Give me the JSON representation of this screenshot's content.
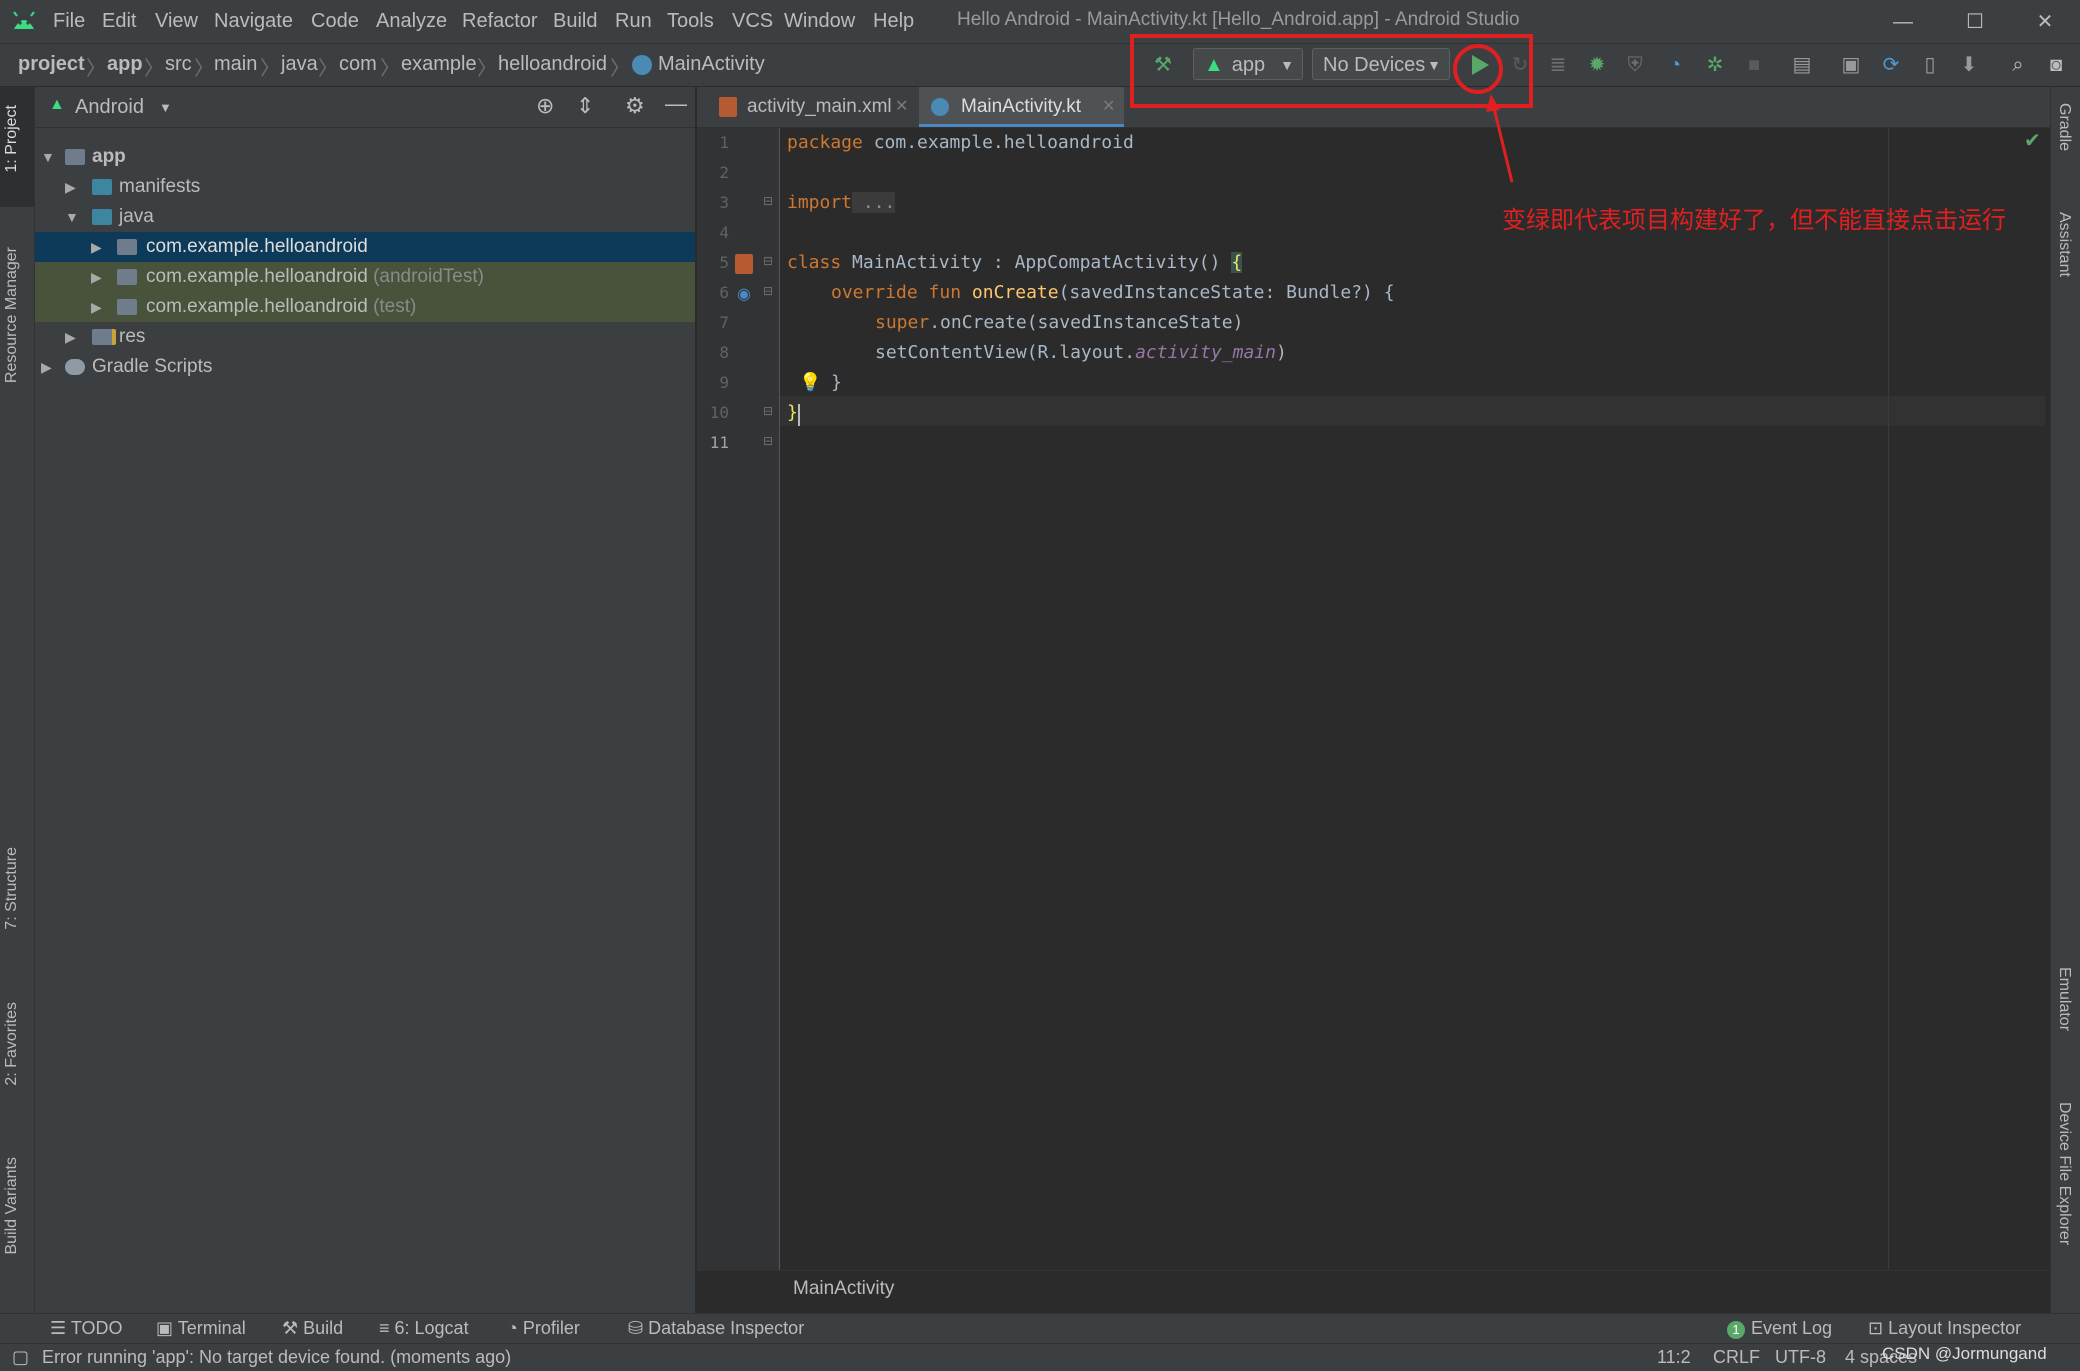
{
  "window": {
    "title": "Hello Android - MainActivity.kt [Hello_Android.app] - Android Studio",
    "minimize_glyph": "—",
    "maximize_glyph": "☐",
    "close_glyph": "✕"
  },
  "menu": [
    "File",
    "Edit",
    "View",
    "Navigate",
    "Code",
    "Analyze",
    "Refactor",
    "Build",
    "Run",
    "Tools",
    "VCS",
    "Window",
    "Help"
  ],
  "breadcrumb": [
    "project",
    "app",
    "src",
    "main",
    "java",
    "com",
    "example",
    "helloandroid",
    "MainActivity"
  ],
  "toolbar": {
    "run_config": "app",
    "device": "No Devices"
  },
  "project_panel": {
    "view_mode": "Android",
    "tree": [
      {
        "label": "app",
        "suffix": ""
      },
      {
        "label": "manifests",
        "suffix": ""
      },
      {
        "label": "java",
        "suffix": ""
      },
      {
        "label": "com.example.helloandroid",
        "suffix": ""
      },
      {
        "label": "com.example.helloandroid",
        "suffix": " (androidTest)"
      },
      {
        "label": "com.example.helloandroid",
        "suffix": " (test)"
      },
      {
        "label": "res",
        "suffix": ""
      },
      {
        "label": "Gradle Scripts",
        "suffix": ""
      }
    ]
  },
  "left_tool_tabs": [
    "1: Project",
    "Resource Manager",
    "7: Structure",
    "2: Favorites",
    "Build Variants"
  ],
  "right_tool_tabs": [
    "Gradle",
    "Assistant",
    "Emulator",
    "Device File Explorer"
  ],
  "editor": {
    "tabs": [
      "activity_main.xml",
      "MainActivity.kt"
    ],
    "active_tab": "MainActivity.kt",
    "line_numbers": [
      "1",
      "2",
      "3",
      "4",
      "5",
      "6",
      "7",
      "8",
      "9",
      "10",
      "11"
    ],
    "code": {
      "l1_kw": "package",
      "l1_rest": " com.example.helloandroid",
      "l3_kw": "import",
      "l3_rest": " ...",
      "l6_kw": "class",
      "l6_rest": " MainActivity : AppCompatActivity() ",
      "l6_brace": "{",
      "l7_kw": "override fun",
      "l7_fn": "onCreate",
      "l7_rest": "(savedInstanceState: Bundle?) {",
      "l8_kw": "super",
      "l8_rest": ".onCreate(savedInstanceState)",
      "l9_pre": "setContentView(R.layout.",
      "l9_it": "activity_main",
      "l9_post": ")",
      "l10": "}",
      "l11": "}"
    },
    "bottom_breadcrumb": "MainActivity"
  },
  "bottom_tool_tabs": [
    "TODO",
    "Terminal",
    "Build",
    "6: Logcat",
    "Profiler",
    "Database Inspector"
  ],
  "bottom_right_tabs": {
    "event_log": "Event Log",
    "event_count": "1",
    "layout_inspector": "Layout Inspector"
  },
  "status": {
    "message": "Error running 'app': No target device found. (moments ago)",
    "position": "11:2",
    "line_sep": "CRLF",
    "encoding": "UTF-8",
    "indent": "4 spaces",
    "watermark": "CSDN @Jormungand"
  },
  "annotation": {
    "text": "变绿即代表项目构建好了，但不能直接点击运行",
    "color": "#e02020"
  },
  "colors": {
    "run_green": "#59a869",
    "android_green": "#3ddc84",
    "selection": "#0d3a58",
    "package_highlight": "#49523a"
  }
}
